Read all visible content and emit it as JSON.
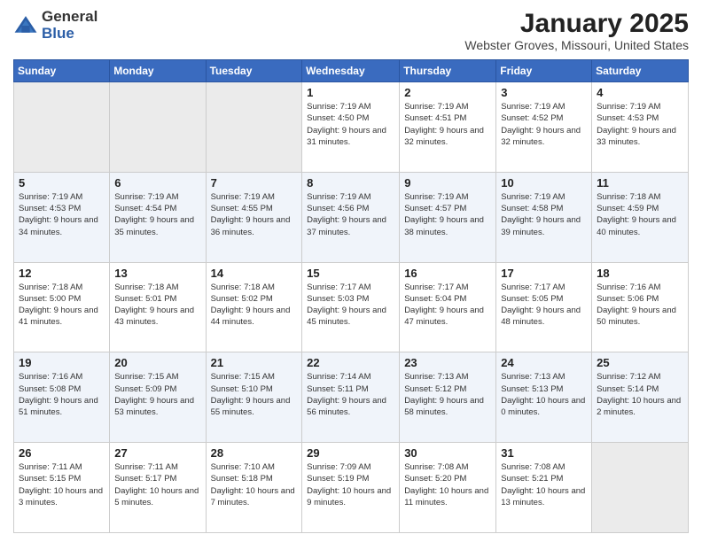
{
  "logo": {
    "general": "General",
    "blue": "Blue"
  },
  "title": "January 2025",
  "subtitle": "Webster Groves, Missouri, United States",
  "days_of_week": [
    "Sunday",
    "Monday",
    "Tuesday",
    "Wednesday",
    "Thursday",
    "Friday",
    "Saturday"
  ],
  "weeks": [
    [
      {
        "day": "",
        "empty": true
      },
      {
        "day": "",
        "empty": true
      },
      {
        "day": "",
        "empty": true
      },
      {
        "day": "1",
        "sunrise": "7:19 AM",
        "sunset": "4:50 PM",
        "daylight": "9 hours and 31 minutes."
      },
      {
        "day": "2",
        "sunrise": "7:19 AM",
        "sunset": "4:51 PM",
        "daylight": "9 hours and 32 minutes."
      },
      {
        "day": "3",
        "sunrise": "7:19 AM",
        "sunset": "4:52 PM",
        "daylight": "9 hours and 32 minutes."
      },
      {
        "day": "4",
        "sunrise": "7:19 AM",
        "sunset": "4:53 PM",
        "daylight": "9 hours and 33 minutes."
      }
    ],
    [
      {
        "day": "5",
        "sunrise": "7:19 AM",
        "sunset": "4:53 PM",
        "daylight": "9 hours and 34 minutes."
      },
      {
        "day": "6",
        "sunrise": "7:19 AM",
        "sunset": "4:54 PM",
        "daylight": "9 hours and 35 minutes."
      },
      {
        "day": "7",
        "sunrise": "7:19 AM",
        "sunset": "4:55 PM",
        "daylight": "9 hours and 36 minutes."
      },
      {
        "day": "8",
        "sunrise": "7:19 AM",
        "sunset": "4:56 PM",
        "daylight": "9 hours and 37 minutes."
      },
      {
        "day": "9",
        "sunrise": "7:19 AM",
        "sunset": "4:57 PM",
        "daylight": "9 hours and 38 minutes."
      },
      {
        "day": "10",
        "sunrise": "7:19 AM",
        "sunset": "4:58 PM",
        "daylight": "9 hours and 39 minutes."
      },
      {
        "day": "11",
        "sunrise": "7:18 AM",
        "sunset": "4:59 PM",
        "daylight": "9 hours and 40 minutes."
      }
    ],
    [
      {
        "day": "12",
        "sunrise": "7:18 AM",
        "sunset": "5:00 PM",
        "daylight": "9 hours and 41 minutes."
      },
      {
        "day": "13",
        "sunrise": "7:18 AM",
        "sunset": "5:01 PM",
        "daylight": "9 hours and 43 minutes."
      },
      {
        "day": "14",
        "sunrise": "7:18 AM",
        "sunset": "5:02 PM",
        "daylight": "9 hours and 44 minutes."
      },
      {
        "day": "15",
        "sunrise": "7:17 AM",
        "sunset": "5:03 PM",
        "daylight": "9 hours and 45 minutes."
      },
      {
        "day": "16",
        "sunrise": "7:17 AM",
        "sunset": "5:04 PM",
        "daylight": "9 hours and 47 minutes."
      },
      {
        "day": "17",
        "sunrise": "7:17 AM",
        "sunset": "5:05 PM",
        "daylight": "9 hours and 48 minutes."
      },
      {
        "day": "18",
        "sunrise": "7:16 AM",
        "sunset": "5:06 PM",
        "daylight": "9 hours and 50 minutes."
      }
    ],
    [
      {
        "day": "19",
        "sunrise": "7:16 AM",
        "sunset": "5:08 PM",
        "daylight": "9 hours and 51 minutes."
      },
      {
        "day": "20",
        "sunrise": "7:15 AM",
        "sunset": "5:09 PM",
        "daylight": "9 hours and 53 minutes."
      },
      {
        "day": "21",
        "sunrise": "7:15 AM",
        "sunset": "5:10 PM",
        "daylight": "9 hours and 55 minutes."
      },
      {
        "day": "22",
        "sunrise": "7:14 AM",
        "sunset": "5:11 PM",
        "daylight": "9 hours and 56 minutes."
      },
      {
        "day": "23",
        "sunrise": "7:13 AM",
        "sunset": "5:12 PM",
        "daylight": "9 hours and 58 minutes."
      },
      {
        "day": "24",
        "sunrise": "7:13 AM",
        "sunset": "5:13 PM",
        "daylight": "10 hours and 0 minutes."
      },
      {
        "day": "25",
        "sunrise": "7:12 AM",
        "sunset": "5:14 PM",
        "daylight": "10 hours and 2 minutes."
      }
    ],
    [
      {
        "day": "26",
        "sunrise": "7:11 AM",
        "sunset": "5:15 PM",
        "daylight": "10 hours and 3 minutes."
      },
      {
        "day": "27",
        "sunrise": "7:11 AM",
        "sunset": "5:17 PM",
        "daylight": "10 hours and 5 minutes."
      },
      {
        "day": "28",
        "sunrise": "7:10 AM",
        "sunset": "5:18 PM",
        "daylight": "10 hours and 7 minutes."
      },
      {
        "day": "29",
        "sunrise": "7:09 AM",
        "sunset": "5:19 PM",
        "daylight": "10 hours and 9 minutes."
      },
      {
        "day": "30",
        "sunrise": "7:08 AM",
        "sunset": "5:20 PM",
        "daylight": "10 hours and 11 minutes."
      },
      {
        "day": "31",
        "sunrise": "7:08 AM",
        "sunset": "5:21 PM",
        "daylight": "10 hours and 13 minutes."
      },
      {
        "day": "",
        "empty": true
      }
    ]
  ],
  "labels": {
    "sunrise": "Sunrise:",
    "sunset": "Sunset:",
    "daylight": "Daylight:"
  }
}
